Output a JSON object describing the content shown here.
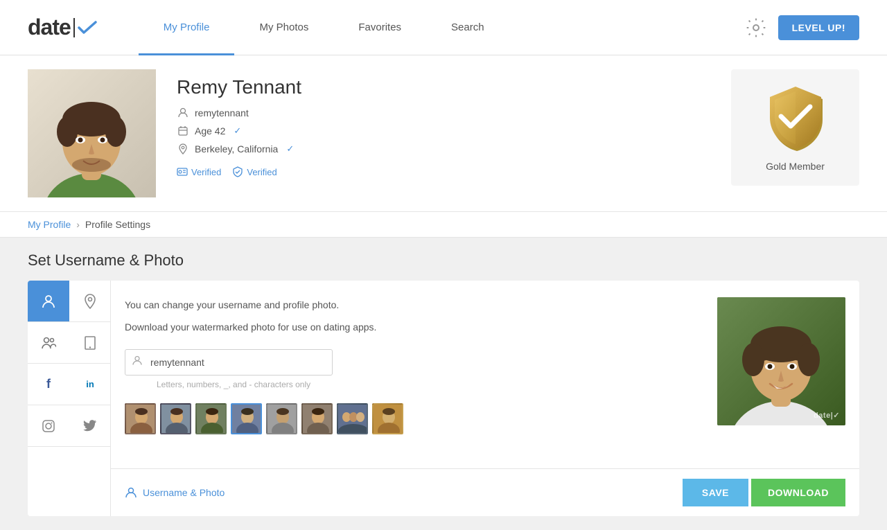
{
  "app": {
    "logo_text": "date|",
    "logo_check_symbol": "✓"
  },
  "header": {
    "nav_items": [
      {
        "id": "my-profile",
        "label": "My Profile",
        "active": true
      },
      {
        "id": "my-photos",
        "label": "My Photos",
        "active": false
      },
      {
        "id": "favorites",
        "label": "Favorites",
        "active": false
      },
      {
        "id": "search",
        "label": "Search",
        "active": false
      }
    ],
    "level_up_label": "LEVEL UP!"
  },
  "profile": {
    "name": "Remy Tennant",
    "username": "remytennant",
    "age_label": "Age 42",
    "location": "Berkeley, California",
    "verified_1": "Verified",
    "verified_2": "Verified",
    "membership": "Gold Member"
  },
  "breadcrumb": {
    "link_label": "My Profile",
    "separator": "›",
    "current": "Profile Settings"
  },
  "section": {
    "title": "Set Username & Photo"
  },
  "content": {
    "description_line1": "You can change your username and profile photo.",
    "description_line2": "Download your watermarked photo for use on dating apps.",
    "username_placeholder": "remytennant",
    "username_hint": "Letters, numbers, _, and - characters only",
    "watermark": "date|✓",
    "bottom_label": "Username & Photo",
    "save_btn": "SAVE",
    "download_btn": "DOWNLOAD"
  },
  "sidebar": {
    "icons": [
      {
        "id": "profile",
        "symbol": "👤",
        "active": true
      },
      {
        "id": "location",
        "symbol": "📍",
        "active": false
      },
      {
        "id": "group",
        "symbol": "👥",
        "active": false
      },
      {
        "id": "phone",
        "symbol": "📞",
        "active": false
      },
      {
        "id": "facebook",
        "symbol": "f",
        "active": false
      },
      {
        "id": "linkedin",
        "symbol": "in",
        "active": false
      },
      {
        "id": "instagram",
        "symbol": "◻",
        "active": false
      },
      {
        "id": "twitter",
        "symbol": "🐦",
        "active": false
      }
    ]
  }
}
